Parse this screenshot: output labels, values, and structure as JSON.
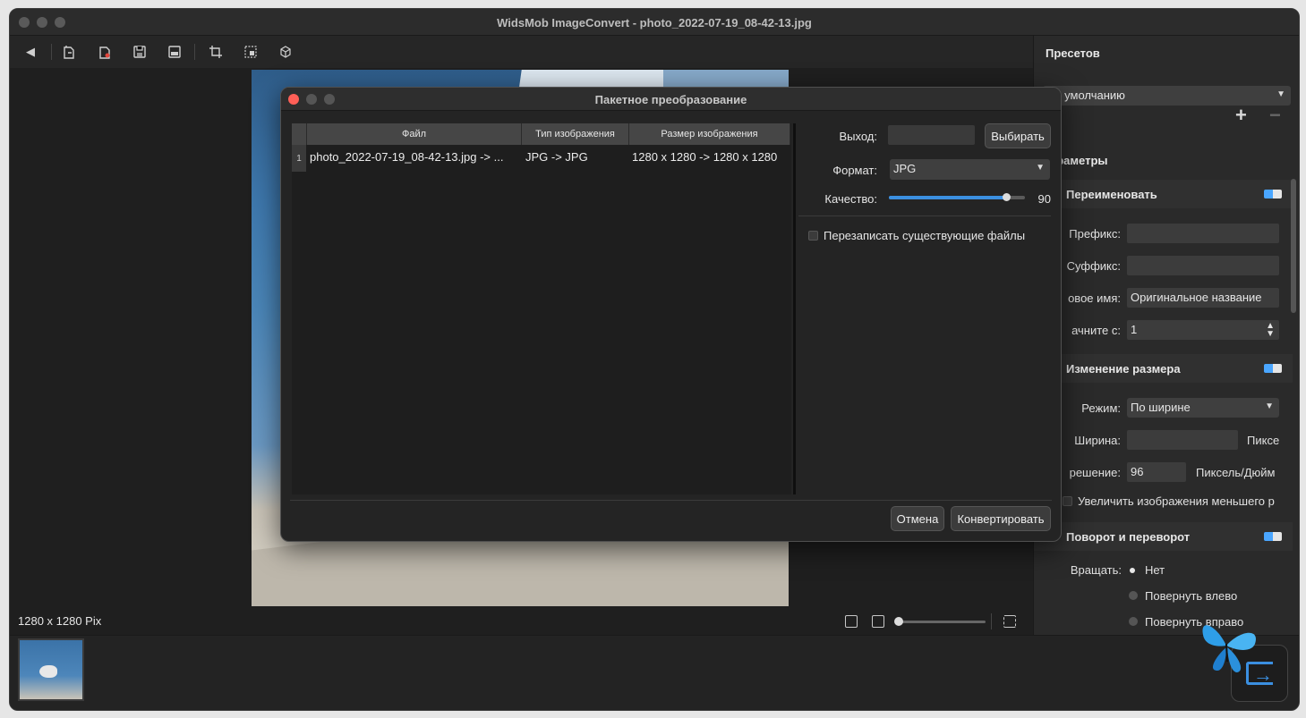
{
  "window": {
    "title": "WidsMob ImageConvert - photo_2022-07-19_08-42-13.jpg"
  },
  "toolbar": {
    "icons": [
      "back-icon",
      "import-icon",
      "remove-icon",
      "save-icon",
      "save-as-icon",
      "crop-icon",
      "resize-icon",
      "3d-box-icon"
    ]
  },
  "status": {
    "dimensions": "1280 x 1280 Pix",
    "zoom_level": 0.0
  },
  "panel": {
    "presets_header": "Пресетов",
    "preset_selected": "По умолчанию",
    "add": "+",
    "remove": "−",
    "params_header": "араметры",
    "rename": {
      "title": "Переименовать",
      "prefix_label": "Префикс:",
      "suffix_label": "Суффикс:",
      "newname_label": "овое имя:",
      "newname_value": "Оригинальное название",
      "start_label": "ачните с:",
      "start_value": "1"
    },
    "resize": {
      "title": "Изменение размера",
      "mode_label": "Режим:",
      "mode_value": "По ширине",
      "width_label": "Ширина:",
      "width_unit": "Пиксе",
      "res_label": "решение:",
      "res_value": "96",
      "res_unit": "Пиксель/Дюйм",
      "enlarge_label": "Увеличить изображения меньшего р"
    },
    "rotate": {
      "title": "Поворот и переворот",
      "rotate_label": "Вращать:",
      "options": [
        "Нет",
        "Повернуть влево",
        "Повернуть вправо"
      ],
      "selected": "Нет"
    }
  },
  "dialog": {
    "title": "Пакетное преобразование",
    "columns": [
      "Файл",
      "Тип изображения",
      "Размер изображения"
    ],
    "rows": [
      {
        "num": "1",
        "file": "photo_2022-07-19_08-42-13.jpg -> ...",
        "type": "JPG -> JPG",
        "size": "1280 x 1280 -> 1280 x 1280"
      }
    ],
    "output_label": "Выход:",
    "output_value": "",
    "choose_button": "Выбирать",
    "format_label": "Формат:",
    "format_value": "JPG",
    "quality_label": "Качество:",
    "quality_value": "90",
    "overwrite_label": "Перезаписать существующие файлы",
    "cancel_button": "Отмена",
    "convert_button": "Конвертировать"
  },
  "colors": {
    "accent": "#3b8fe0",
    "close": "#ff5f57"
  }
}
